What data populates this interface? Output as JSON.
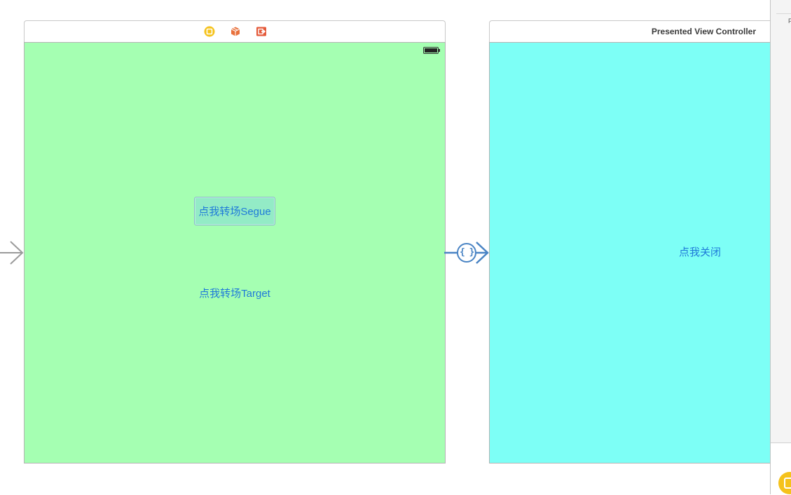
{
  "scene1": {
    "segue_button_label": "点我转场Segue",
    "target_button_label": "点我转场Target",
    "background_color": "#a5ffb2",
    "scene_dock_icons": [
      "view-controller-icon",
      "first-responder-icon",
      "exit-icon"
    ]
  },
  "segue": {
    "badge_symbol": "{ }",
    "color": "#4a84c4"
  },
  "scene2": {
    "title": "Presented View Controller",
    "close_button_label": "点我关闭",
    "background_color": "#7dfff6"
  },
  "side_panel": {
    "truncated_text": "F"
  },
  "colors": {
    "link_blue": "#1f7ad9",
    "vc_icon_yellow": "#f5c21b",
    "first_responder_orange": "#e8713c",
    "exit_red": "#e45a3a"
  }
}
